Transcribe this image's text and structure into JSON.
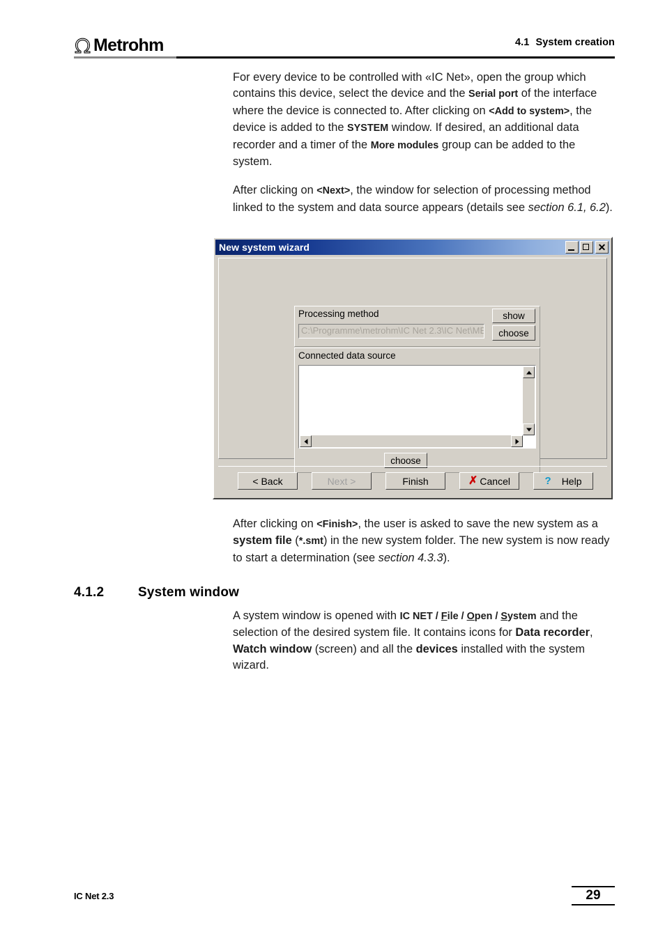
{
  "header": {
    "logo_text": "Metrohm",
    "logo_icon": "omega-mark",
    "section_number": "4.1",
    "section_title": "System creation"
  },
  "content": {
    "paragraph_1": {
      "part_1": "For every device to be controlled with «IC Net», open the group which contains this device, select the device and the ",
      "bold_1": "Serial port",
      "part_2": " of the interface where the device is connected to. After clicking on ",
      "bold_2": "<Add to system>",
      "part_3": ", the device is added to the ",
      "bold_3": "SYSTEM",
      "part_4": " window. If desired, an additional data recorder and a timer of the ",
      "bold_4": "More modules",
      "part_5": " group can be added to the system."
    },
    "paragraph_2": {
      "part_1": "After clicking on ",
      "bold_1": "<Next>",
      "part_2": ", the window for selection of processing method linked to the system and data source appears (details see ",
      "italic_1": "section 6.1, 6.2",
      "part_3": ")."
    },
    "paragraph_3": {
      "part_1": "After clicking on ",
      "bold_1": "<Finish>",
      "part_2": ", the user is asked to save the new system as a ",
      "bold_2": "system file",
      "part_3": " (",
      "bold_3": "*.smt",
      "part_4": ") in the new system folder. The new system is now ready to start a determination (see ",
      "italic_1": "section 4.3.3",
      "part_5": ")."
    },
    "section_heading": {
      "number": "4.1.2",
      "title": "System window"
    },
    "paragraph_4": {
      "part_1": "A system window is opened with ",
      "bold_1": "IC NET",
      "sep_1": " / ",
      "bold_2_u": "F",
      "bold_2_rest": "ile",
      "sep_2": " / ",
      "bold_3_u": "O",
      "bold_3_rest": "pen",
      "sep_3": " / ",
      "bold_4_u": "S",
      "bold_4_rest": "ystem",
      "part_2": " and the selection of the desired system file. It contains icons for ",
      "bold_5": "Data recorder",
      "part_3": ", ",
      "bold_6": "Watch window",
      "part_4": " (screen) and all the ",
      "bold_7": "devices",
      "part_5": " installed with the system wizard."
    }
  },
  "dialog": {
    "title": "New system wizard",
    "window_buttons": {
      "minimize": "minimize-icon",
      "maximize": "maximize-icon",
      "close": "✕"
    },
    "processing_method": {
      "label": "Processing method",
      "path_value": "C:\\Programme\\metrohm\\IC Net 2.3\\IC Net\\ME",
      "show_button": "show",
      "choose_button": "choose"
    },
    "data_source": {
      "label": "Connected  data source",
      "list_items": [],
      "choose_button": "choose"
    },
    "footer_buttons": {
      "back": "< Back",
      "next": "Next >",
      "finish": "Finish",
      "cancel": "Cancel",
      "help": "Help"
    },
    "colors": {
      "face": "#d4d0c8",
      "title_dark": "#0a246a",
      "title_light": "#b6cdea",
      "cancel_icon": "#cc0000",
      "help_icon": "#1199cc"
    }
  },
  "footer": {
    "product": "IC Net 2.3",
    "page_number": "29"
  }
}
